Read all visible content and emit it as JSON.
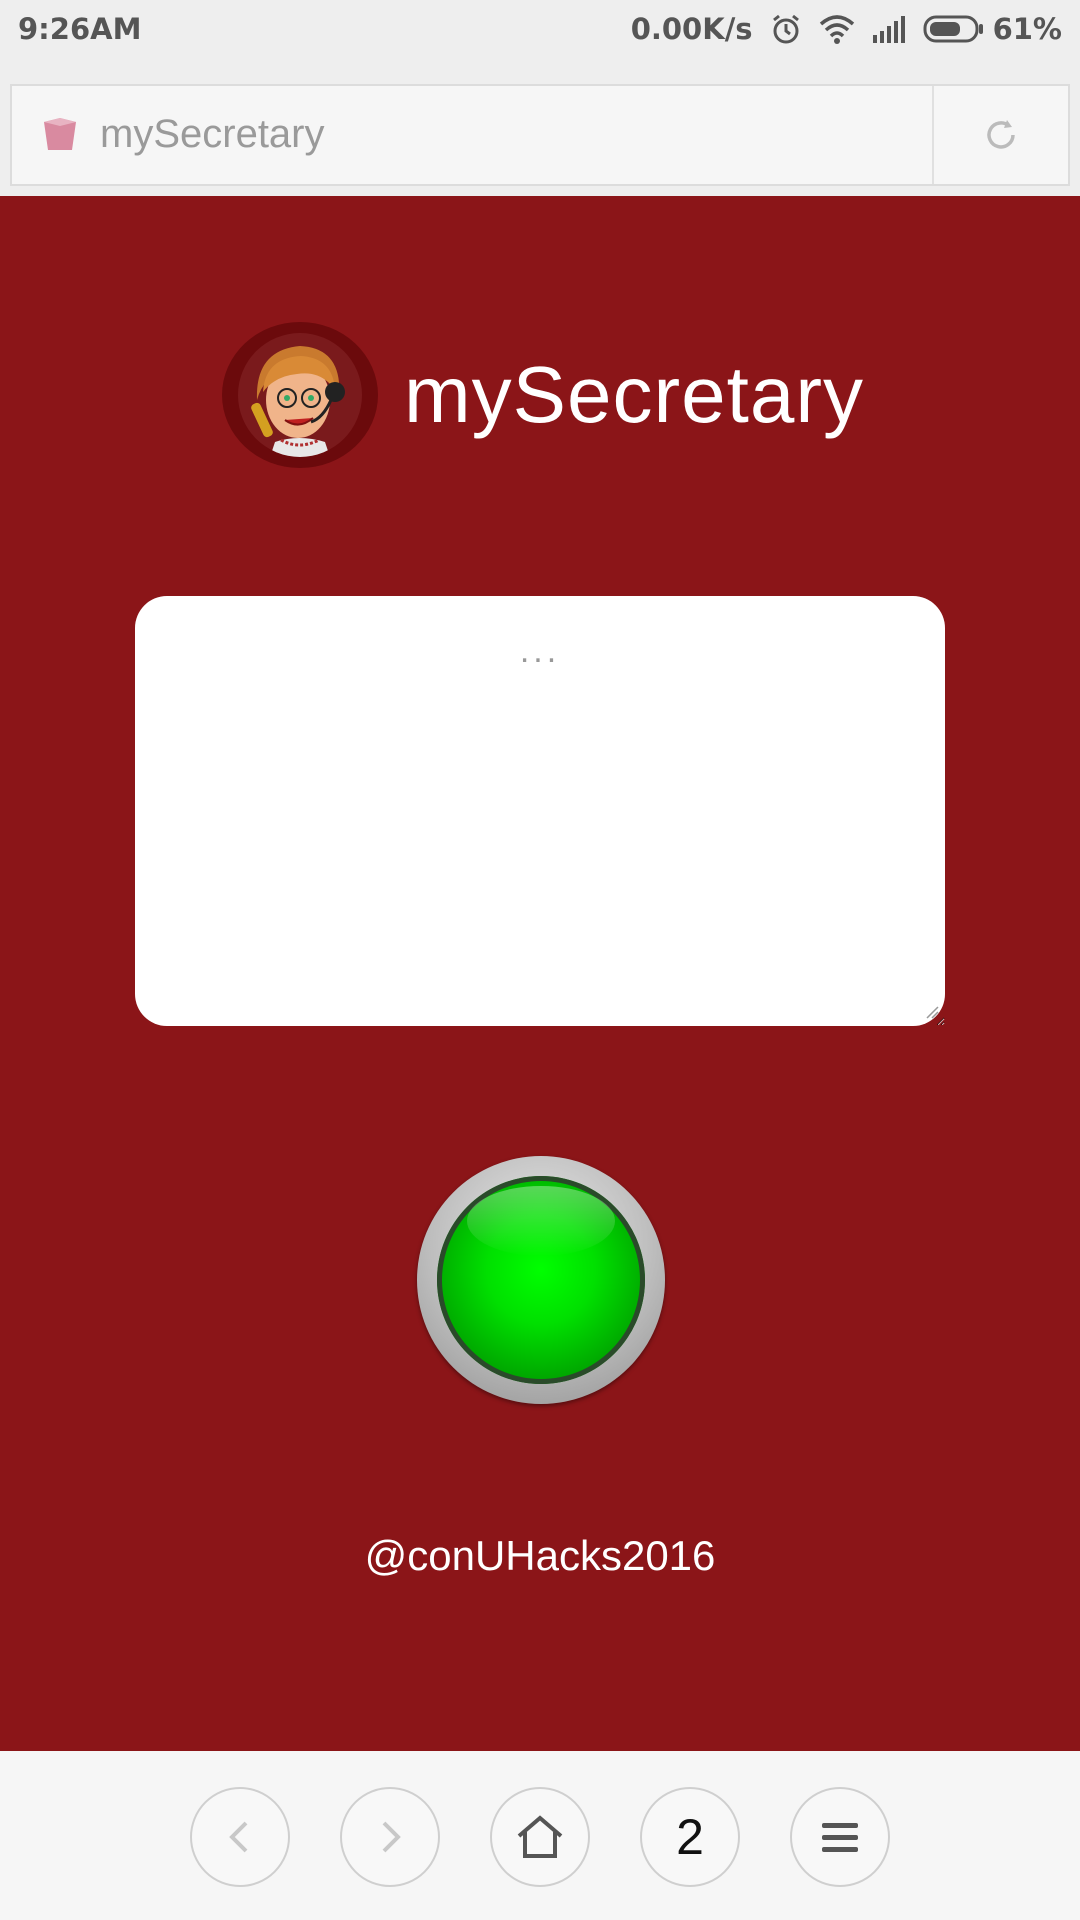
{
  "status_bar": {
    "time": "9:26AM",
    "network_speed": "0.00K/s",
    "battery_percent": "61%",
    "battery_level": 0.61,
    "icons": [
      "alarm-icon",
      "wifi-icon",
      "signal-icon",
      "battery-icon"
    ]
  },
  "browser": {
    "address_text": "mySecretary",
    "site_icon": "favicon-icon",
    "reload_icon": "reload-icon"
  },
  "page": {
    "title": "mySecretary",
    "avatar": "secretary-avatar",
    "textbox_placeholder": "...",
    "textbox_value": "",
    "go_button_icon": "green-round-button",
    "footer": "@conUHacks2016",
    "colors": {
      "background": "#8b1518",
      "button_green": "#00e000"
    }
  },
  "nav": {
    "back_icon": "chevron-left-icon",
    "forward_icon": "chevron-right-icon",
    "home_icon": "home-icon",
    "tab_count": "2",
    "menu_icon": "menu-icon"
  }
}
